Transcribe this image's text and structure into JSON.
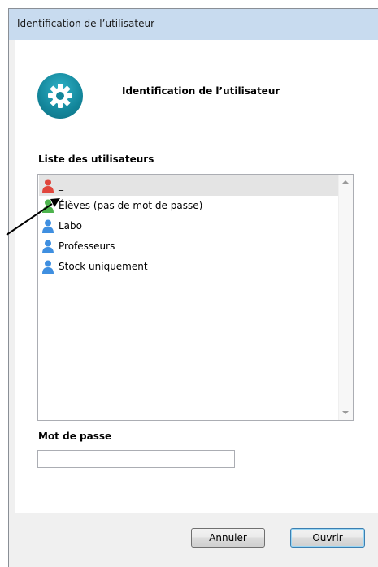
{
  "window": {
    "title": "Identification de l’utilisateur"
  },
  "header": {
    "title": "Identification de l’utilisateur",
    "logo_icon": "gear-icon",
    "logo_color": "#13869b"
  },
  "users": {
    "label": "Liste des utilisateurs",
    "items": [
      {
        "label": "_",
        "icon_color": "#e0463c"
      },
      {
        "label": "Élèves (pas de mot de passe)",
        "icon_color": "#4db34d"
      },
      {
        "label": "Labo",
        "icon_color": "#3f8fe0"
      },
      {
        "label": "Professeurs",
        "icon_color": "#3f8fe0"
      },
      {
        "label": "Stock uniquement",
        "icon_color": "#3f8fe0"
      }
    ]
  },
  "password": {
    "label": "Mot de passe",
    "value": ""
  },
  "buttons": {
    "cancel": "Annuler",
    "open": "Ouvrir"
  }
}
